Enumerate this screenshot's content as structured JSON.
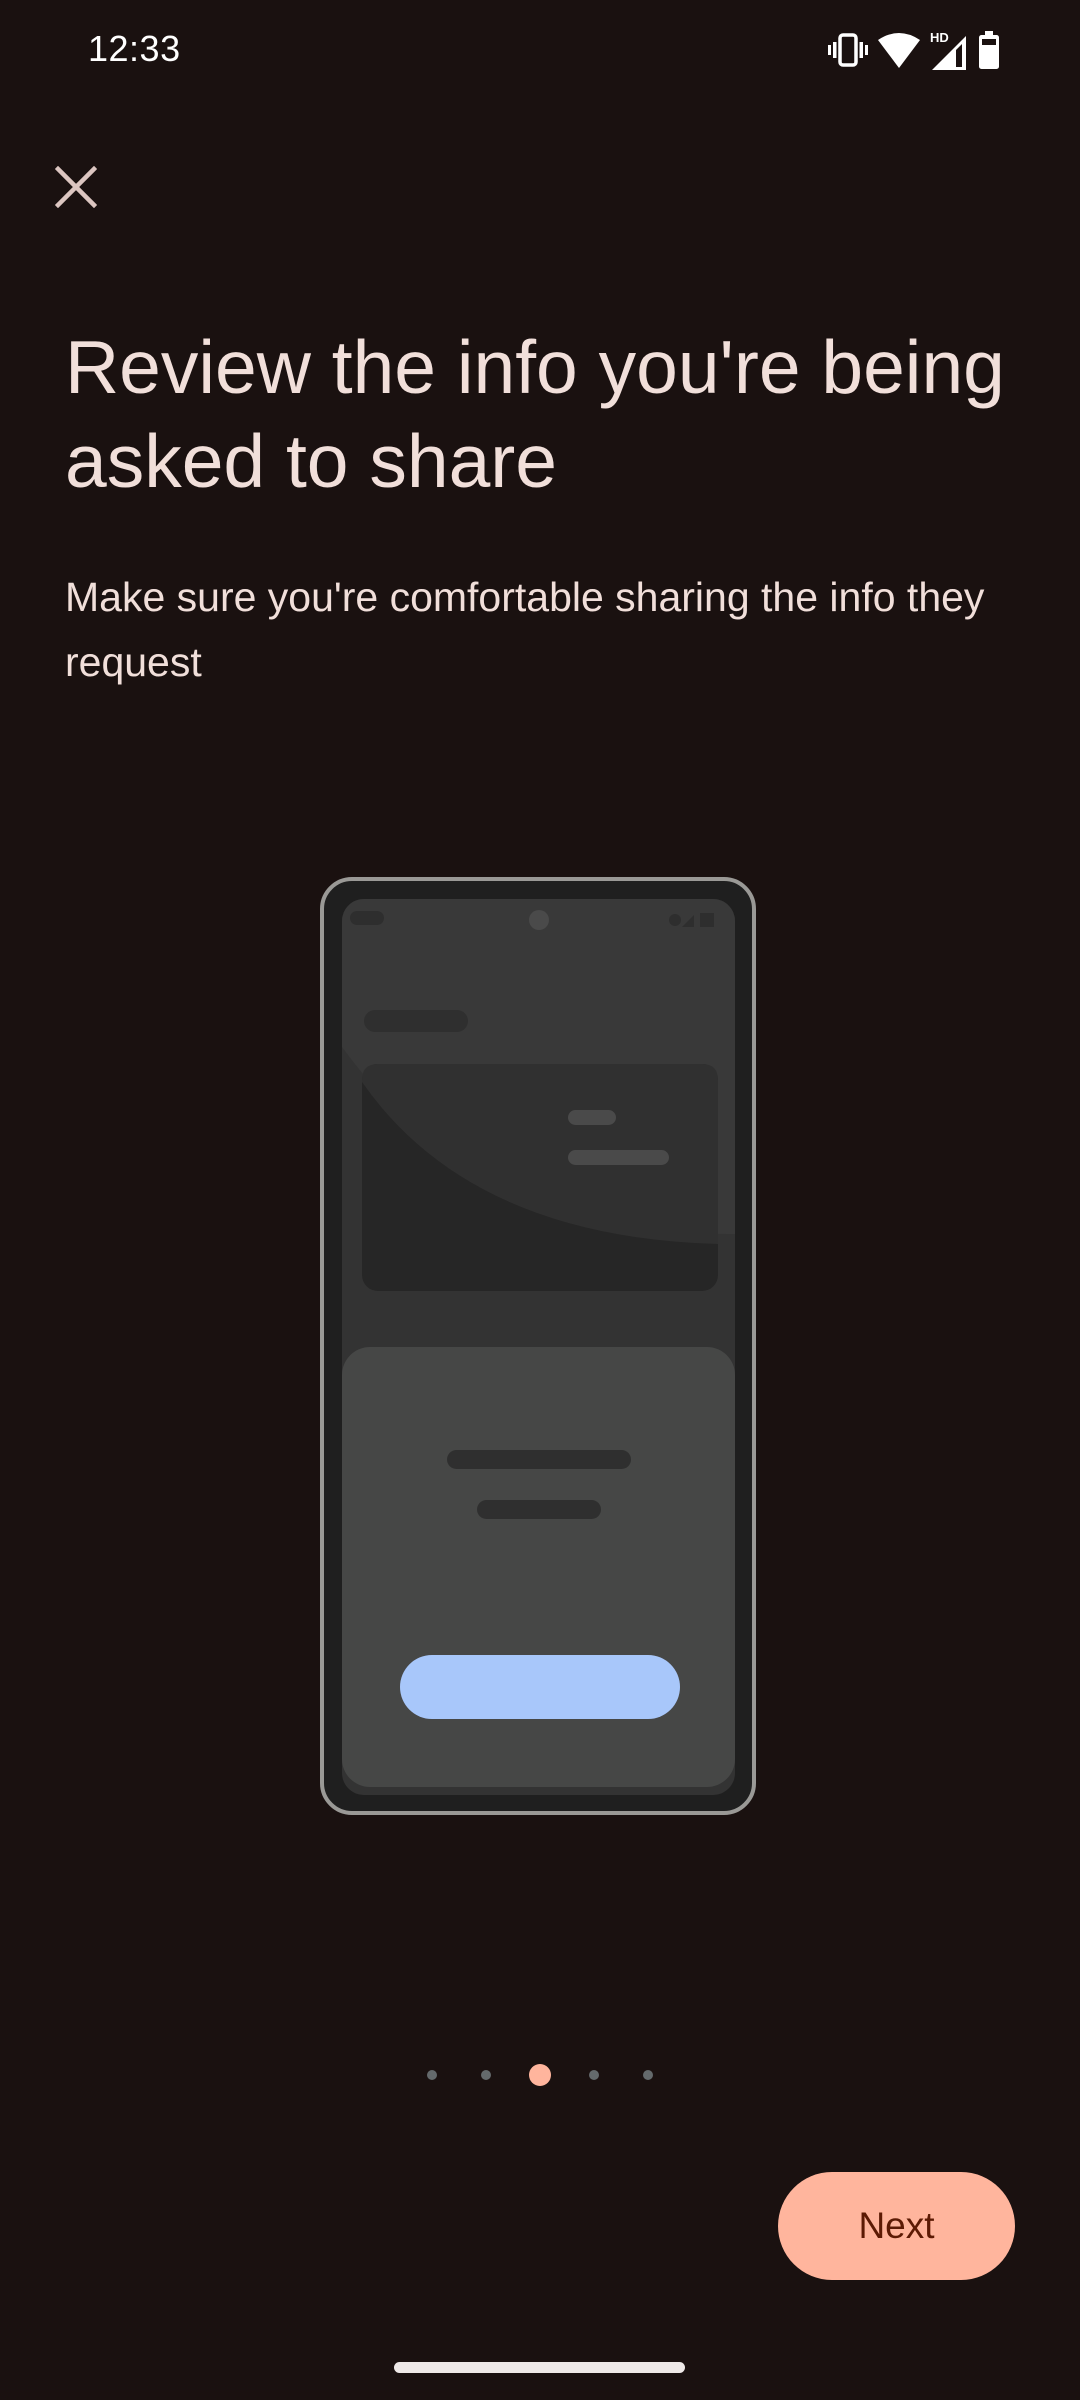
{
  "status_bar": {
    "time": "12:33",
    "icons": [
      "vibrate-icon",
      "wifi-icon",
      "hd-signal-icon",
      "battery-icon"
    ],
    "network_badge": "HD"
  },
  "header": {
    "close_icon": "close-icon",
    "close_label": "Close"
  },
  "content": {
    "title": "Review the info you're being asked to share",
    "subtitle": "Make sure you're comfortable sharing the info they request"
  },
  "illustration": {
    "description": "phone-mockup",
    "accent_color": "#a8c7fa"
  },
  "pager": {
    "total": 5,
    "current": 3
  },
  "footer": {
    "next_label": "Next"
  },
  "colors": {
    "background": "#1a1110",
    "text": "#f1dfda",
    "primary": "#ffb59d",
    "on_primary": "#5c1a04",
    "inactive_dot": "#646a6c"
  }
}
